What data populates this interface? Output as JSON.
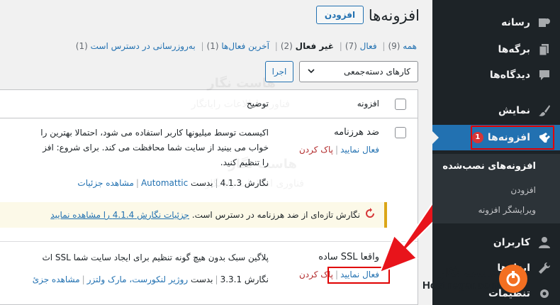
{
  "sidebar": {
    "items": [
      {
        "key": "media",
        "label": "رسانه",
        "icon": "media-icon"
      },
      {
        "key": "pages",
        "label": "برگه‌ها",
        "icon": "pages-icon"
      },
      {
        "key": "comments",
        "label": "دیدگاه‌ها",
        "icon": "comments-icon"
      },
      {
        "key": "appearance",
        "label": "نمایش",
        "icon": "brush-icon"
      },
      {
        "key": "plugins",
        "label": "افزونه‌ها",
        "icon": "plugin-icon",
        "badge": "1"
      },
      {
        "key": "users",
        "label": "کاربران",
        "icon": "user-icon"
      },
      {
        "key": "tools",
        "label": "ابزارها",
        "icon": "wrench-icon"
      },
      {
        "key": "settings",
        "label": "تنظیمات",
        "icon": "settings-icon"
      }
    ],
    "submenu": [
      "افزونه‌های نصب‌شده",
      "افزودن",
      "ویرایشگر افزونه"
    ]
  },
  "header": {
    "title": "افزونه‌ها",
    "add_new": "افزودن"
  },
  "filters": {
    "all": "همه",
    "all_count": "(9)",
    "active": "فعال",
    "active_count": "(7)",
    "inactive": "غیر فعال",
    "inactive_count": "(2)",
    "recent": "آخرین فعال‌ها",
    "recent_count": "(1)",
    "updates": "به‌روزرسانی در دسترس است",
    "updates_count": "(1)"
  },
  "bulk": {
    "placeholder": "کارهای دسته‌جمعی",
    "apply": "اجرا"
  },
  "table": {
    "col_plugin": "افزونه",
    "col_desc": "توضیح",
    "rows": [
      {
        "name": "ضد هرزنامه",
        "activate": "فعال نمایید",
        "delete": "پاک کردن",
        "desc_line1": "اکیسمت توسط میلیونها کاربر استفاده می شود، احتمالا بهترین را",
        "desc_line2": "خواب می بینید از سایت شما محافظت می کند. برای شروع: افز",
        "desc_line3": "را تنظیم کنید.",
        "version": "نگارش 4.1.3",
        "by": "بدست",
        "author": "Automattic",
        "details": "مشاهده جزئیات"
      },
      {
        "name": "واقعا SSL ساده",
        "activate": "فعال نمایید",
        "delete": "پاک کردن",
        "desc_line1": "پلاگین سبک بدون هیچ گونه تنظیم برای ایجاد سایت شما SSL اث",
        "version": "نگارش 3.3.1",
        "by": "بدست",
        "author": "روژیر لنکورست، مارک ولتزر",
        "details": "مشاهده جزئ"
      }
    ],
    "update_notice": {
      "text": "نگارش تازه‌ای از ضد هرزنامه در دسترس است.",
      "link": "جزئیات نگارش 4.1.4 را مشاهده نمایید"
    }
  },
  "watermark": {
    "brand": "هاست نگار",
    "tagline": "فناوری اطلاعات رایانگار"
  },
  "logo": {
    "fa": "هاست نگار",
    "en": "Hostnegar.com"
  }
}
